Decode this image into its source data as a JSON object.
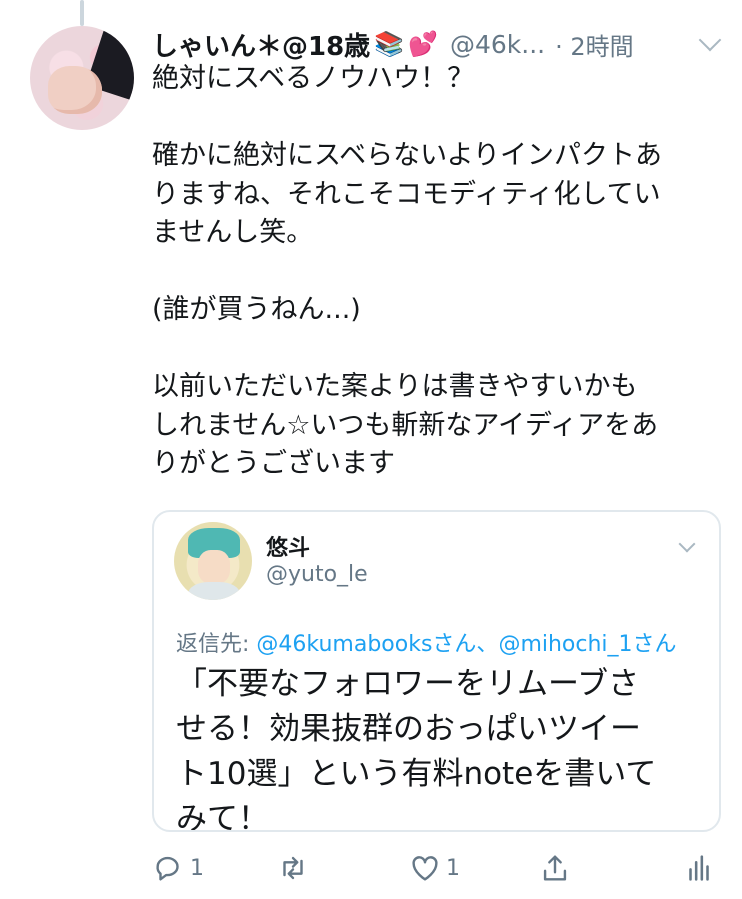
{
  "tweet": {
    "display_name": "しゃいん＊@18歳",
    "emoji_books": "📚",
    "emoji_hearts": "💕",
    "handle": "@46k...",
    "timestamp": "· 2時間",
    "lines": [
      "絶対にスベるノウハウ！？",
      "",
      "確かに絶対にスベらないよりインパクトあ",
      "りますね、それこそコモディティ化してい",
      "ませんし笑。",
      "",
      "(誰が買うねん...)",
      "",
      "以前いただいた案よりは書きやすいかも",
      "しれません☆いつも斬新なアイディアをあ",
      "りがとうございます"
    ]
  },
  "quote": {
    "display_name": "悠斗",
    "handle": "@yuto_le",
    "reply_prefix": "返信先: ",
    "reply_mention_1": "@46kumabooksさん",
    "reply_separator": "、",
    "reply_mention_2": "@mihochi_1さん",
    "lines": [
      "「不要なフォロワーをリムーブさ",
      "せる！効果抜群のおっぱいツイー",
      "ト10選」という有料noteを書いて",
      "みて！"
    ]
  },
  "actions": {
    "reply_count": "1",
    "like_count": "1"
  },
  "colors": {
    "accent": "#1da1f2",
    "muted": "#657786",
    "border": "#e1e8ed",
    "text": "#14171a"
  },
  "icons": [
    "reply-icon",
    "retweet-icon",
    "like-icon",
    "share-icon",
    "analytics-icon",
    "chevron-down-icon"
  ]
}
